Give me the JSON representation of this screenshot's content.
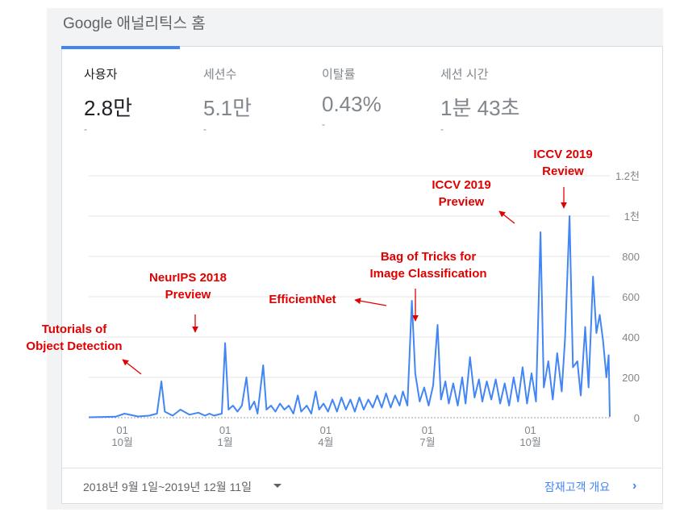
{
  "page_title": "Google 애널리틱스 홈",
  "metrics": [
    {
      "label": "사용자",
      "value": "2.8만",
      "change": "-"
    },
    {
      "label": "세션수",
      "value": "5.1만",
      "change": "-"
    },
    {
      "label": "이탈률",
      "value": "0.43%",
      "change": "-"
    },
    {
      "label": "세션 시간",
      "value": "1분 43초",
      "change": "-"
    }
  ],
  "footer": {
    "date_range": "2018년 9월 1일~2019년 12월 11일",
    "audience_link": "잠재고객 개요"
  },
  "colors": {
    "line": "#4285f4",
    "annotation": "#e00000",
    "tab_active": "#4285f4"
  },
  "chart_data": {
    "type": "line",
    "y_ticks": [
      "0",
      "200",
      "400",
      "600",
      "800",
      "1천",
      "1.2천"
    ],
    "ylim": [
      0,
      1200
    ],
    "x_ticks": [
      {
        "day": "01",
        "month": "10월"
      },
      {
        "day": "01",
        "month": "1월"
      },
      {
        "day": "01",
        "month": "4월"
      },
      {
        "day": "01",
        "month": "7월"
      },
      {
        "day": "01",
        "month": "10월"
      }
    ],
    "x_tick_dates": [
      "2018-10-01",
      "2019-01-01",
      "2019-04-01",
      "2019-07-01",
      "2019-10-01"
    ],
    "x_range": [
      "2018-09-01",
      "2019-12-11"
    ],
    "series": [
      {
        "points": [
          [
            "2018-09-01",
            2
          ],
          [
            "2018-09-25",
            5
          ],
          [
            "2018-10-03",
            20
          ],
          [
            "2018-10-15",
            6
          ],
          [
            "2018-10-25",
            10
          ],
          [
            "2018-11-01",
            20
          ],
          [
            "2018-11-05",
            180
          ],
          [
            "2018-11-08",
            30
          ],
          [
            "2018-11-15",
            10
          ],
          [
            "2018-11-22",
            40
          ],
          [
            "2018-11-30",
            15
          ],
          [
            "2018-12-08",
            25
          ],
          [
            "2018-12-14",
            10
          ],
          [
            "2018-12-18",
            20
          ],
          [
            "2018-12-22",
            10
          ],
          [
            "2018-12-29",
            20
          ],
          [
            "2019-01-01",
            370
          ],
          [
            "2019-01-04",
            40
          ],
          [
            "2019-01-08",
            60
          ],
          [
            "2019-01-12",
            30
          ],
          [
            "2019-01-16",
            60
          ],
          [
            "2019-01-20",
            200
          ],
          [
            "2019-01-23",
            40
          ],
          [
            "2019-01-27",
            80
          ],
          [
            "2019-01-30",
            20
          ],
          [
            "2019-02-04",
            260
          ],
          [
            "2019-02-07",
            40
          ],
          [
            "2019-02-11",
            60
          ],
          [
            "2019-02-15",
            30
          ],
          [
            "2019-02-19",
            70
          ],
          [
            "2019-02-23",
            40
          ],
          [
            "2019-02-27",
            60
          ],
          [
            "2019-03-03",
            20
          ],
          [
            "2019-03-07",
            110
          ],
          [
            "2019-03-10",
            30
          ],
          [
            "2019-03-15",
            60
          ],
          [
            "2019-03-19",
            20
          ],
          [
            "2019-03-23",
            130
          ],
          [
            "2019-03-26",
            40
          ],
          [
            "2019-03-30",
            70
          ],
          [
            "2019-04-03",
            30
          ],
          [
            "2019-04-07",
            90
          ],
          [
            "2019-04-11",
            30
          ],
          [
            "2019-04-15",
            100
          ],
          [
            "2019-04-19",
            40
          ],
          [
            "2019-04-23",
            90
          ],
          [
            "2019-04-27",
            30
          ],
          [
            "2019-05-01",
            100
          ],
          [
            "2019-05-05",
            40
          ],
          [
            "2019-05-09",
            90
          ],
          [
            "2019-05-13",
            50
          ],
          [
            "2019-05-17",
            110
          ],
          [
            "2019-05-21",
            50
          ],
          [
            "2019-05-25",
            120
          ],
          [
            "2019-05-29",
            50
          ],
          [
            "2019-06-02",
            110
          ],
          [
            "2019-06-06",
            60
          ],
          [
            "2019-06-09",
            130
          ],
          [
            "2019-06-13",
            60
          ],
          [
            "2019-06-17",
            580
          ],
          [
            "2019-06-20",
            220
          ],
          [
            "2019-06-24",
            80
          ],
          [
            "2019-06-28",
            150
          ],
          [
            "2019-07-02",
            60
          ],
          [
            "2019-07-06",
            160
          ],
          [
            "2019-07-10",
            460
          ],
          [
            "2019-07-13",
            90
          ],
          [
            "2019-07-17",
            180
          ],
          [
            "2019-07-20",
            70
          ],
          [
            "2019-07-24",
            170
          ],
          [
            "2019-07-28",
            60
          ],
          [
            "2019-08-01",
            200
          ],
          [
            "2019-08-04",
            70
          ],
          [
            "2019-08-08",
            300
          ],
          [
            "2019-08-12",
            100
          ],
          [
            "2019-08-16",
            190
          ],
          [
            "2019-08-19",
            80
          ],
          [
            "2019-08-23",
            180
          ],
          [
            "2019-08-27",
            90
          ],
          [
            "2019-08-31",
            190
          ],
          [
            "2019-09-04",
            70
          ],
          [
            "2019-09-08",
            170
          ],
          [
            "2019-09-12",
            60
          ],
          [
            "2019-09-16",
            200
          ],
          [
            "2019-09-20",
            80
          ],
          [
            "2019-09-24",
            250
          ],
          [
            "2019-09-28",
            70
          ],
          [
            "2019-10-02",
            220
          ],
          [
            "2019-10-06",
            80
          ],
          [
            "2019-10-10",
            920
          ],
          [
            "2019-10-13",
            150
          ],
          [
            "2019-10-17",
            280
          ],
          [
            "2019-10-21",
            90
          ],
          [
            "2019-10-25",
            320
          ],
          [
            "2019-10-29",
            130
          ],
          [
            "2019-11-01",
            390
          ],
          [
            "2019-11-05",
            1000
          ],
          [
            "2019-11-08",
            250
          ],
          [
            "2019-11-12",
            280
          ],
          [
            "2019-11-15",
            110
          ],
          [
            "2019-11-19",
            450
          ],
          [
            "2019-11-22",
            150
          ],
          [
            "2019-11-26",
            700
          ],
          [
            "2019-11-29",
            420
          ],
          [
            "2019-12-02",
            510
          ],
          [
            "2019-12-05",
            380
          ],
          [
            "2019-12-08",
            200
          ],
          [
            "2019-12-10",
            310
          ],
          [
            "2019-12-11",
            5
          ]
        ]
      }
    ],
    "annotations": [
      {
        "lines": [
          "Tutorials of",
          "Object Detection"
        ]
      },
      {
        "lines": [
          "NeurIPS 2018",
          "Preview"
        ]
      },
      {
        "lines": [
          "EfficientNet"
        ]
      },
      {
        "lines": [
          "Bag of Tricks for",
          "Image Classification"
        ]
      },
      {
        "lines": [
          "ICCV 2019",
          "Preview"
        ]
      },
      {
        "lines": [
          "ICCV 2019",
          "Review"
        ]
      }
    ]
  }
}
